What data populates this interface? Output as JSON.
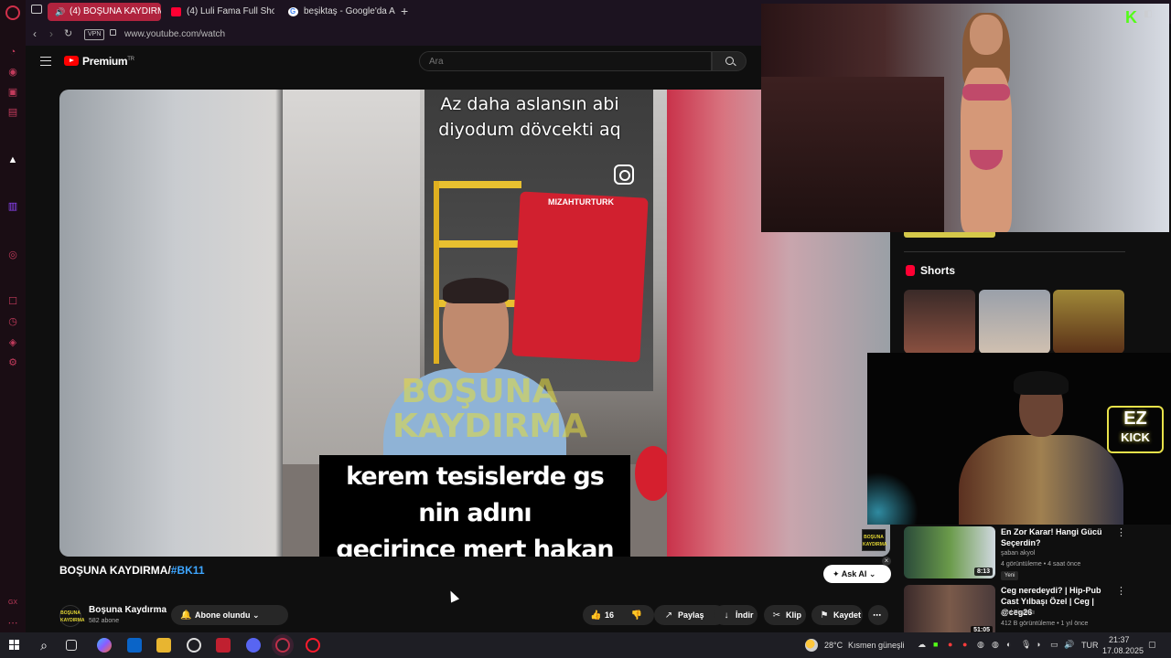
{
  "browser": {
    "tabs": [
      {
        "label": "(4) BOŞUNA KAYDIRMA",
        "active": true
      },
      {
        "label": "(4) Luli Fama Full Show in",
        "active": false
      },
      {
        "label": "beşiktaş - Google'da Ara",
        "active": false
      }
    ],
    "vpn": "VPN",
    "url": "www.youtube.com/watch"
  },
  "youtube": {
    "brand": "Premium",
    "brand_region": "TR",
    "search_placeholder": "Ara",
    "video": {
      "overlay_text_line1": "Az daha aslansın abi",
      "overlay_text_line2": "diyodum  dövcekti aq",
      "chair_text": "MIZAHTURTURK",
      "watermark_line1": "BOŞUNA",
      "watermark_line2": "KAYDIRMA",
      "caption_line1": "kerem tesislerde gs nin adını",
      "caption_line2": "geçirince mert hakan"
    },
    "title_prefix": "BOŞUNA KAYDIRMA/",
    "title_tag": "#BK11",
    "channel": {
      "name": "Boşuna Kaydırma",
      "subs": "582 abone",
      "avatar_text": "BOŞUNA KAYDIRMA",
      "subscribe_label": "Abone olundu"
    },
    "actions": {
      "likes": "16",
      "share": "Paylaş",
      "download": "İndir",
      "clip": "Klip",
      "save": "Kaydet"
    },
    "ask_ai": "Ask AI",
    "shorts_label": "Shorts",
    "recommendations": [
      {
        "title": "En Zor Karar! Hangi Gücü Seçerdin?",
        "channel": "şaban akyol",
        "meta": "4 görüntüleme • 4 saat önce",
        "badge": "Yeni",
        "duration": "8:13"
      },
      {
        "title": "Ceg neredeydi? | Hip-Pub Cast Yılbaşı Özel | Ceg | @ceg26",
        "channel": "Anıl Piyancı",
        "meta": "412 B görüntüleme • 1 yıl önce",
        "duration": "51:05"
      }
    ]
  },
  "stream_overlay": {
    "badge_line1": "EZ",
    "badge_line2": "KICK",
    "kick_logo": "K"
  },
  "taskbar": {
    "weather_temp": "28°C",
    "weather_desc": "Kısmen güneşli",
    "lang": "TUR",
    "time": "21:37",
    "date": "17.08.2025"
  },
  "colors": {
    "opera_red": "#d0304a",
    "yt_red": "#ff0000",
    "link_blue": "#3ea6ff",
    "kick_green": "#53fc18"
  }
}
